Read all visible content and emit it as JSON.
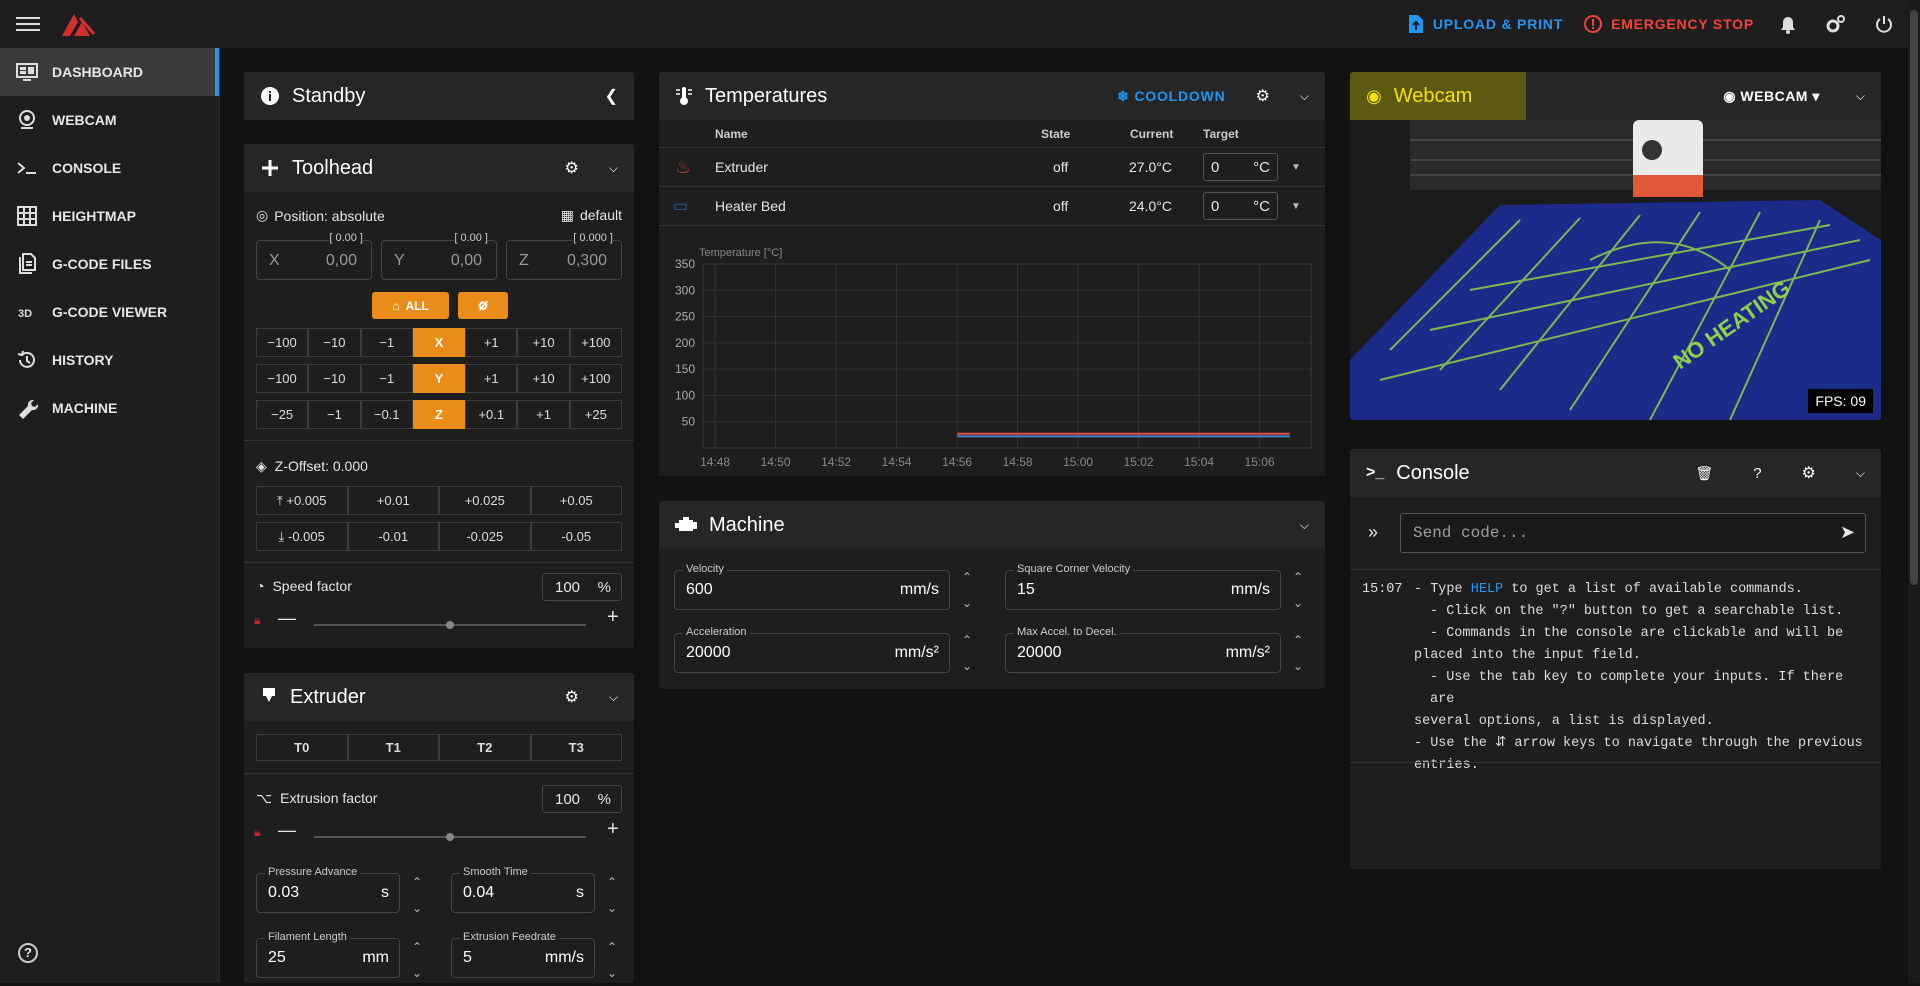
{
  "topbar": {
    "upload_label": "UPLOAD & PRINT",
    "estop_label": "EMERGENCY STOP"
  },
  "nav": [
    {
      "label": "DASHBOARD",
      "icon": "monitor-dashboard-icon"
    },
    {
      "label": "WEBCAM",
      "icon": "webcam-icon"
    },
    {
      "label": "CONSOLE",
      "icon": "console-icon"
    },
    {
      "label": "HEIGHTMAP",
      "icon": "grid-icon"
    },
    {
      "label": "G-CODE FILES",
      "icon": "file-document-icon"
    },
    {
      "label": "G-CODE VIEWER",
      "icon": "3d-icon"
    },
    {
      "label": "HISTORY",
      "icon": "history-icon"
    },
    {
      "label": "MACHINE",
      "icon": "wrench-icon"
    }
  ],
  "standby": {
    "title": "Standby"
  },
  "toolhead": {
    "title": "Toolhead",
    "position_label": "Position: absolute",
    "profile": "default",
    "axes": [
      {
        "name": "X",
        "value": "0,00",
        "hint": "[ 0.00 ]"
      },
      {
        "name": "Y",
        "value": "0,00",
        "hint": "[ 0.00 ]"
      },
      {
        "name": "Z",
        "value": "0,300",
        "hint": "[ 0.000 ]"
      }
    ],
    "home_all": "ALL",
    "x_row": [
      "−100",
      "−10",
      "−1",
      "X",
      "+1",
      "+10",
      "+100"
    ],
    "y_row": [
      "−100",
      "−10",
      "−1",
      "Y",
      "+1",
      "+10",
      "+100"
    ],
    "z_row": [
      "−25",
      "−1",
      "−0.1",
      "Z",
      "+0.1",
      "+1",
      "+25"
    ],
    "zoffset_label": "Z-Offset: 0.000",
    "zoff_up": [
      "+0.005",
      "+0.01",
      "+0.025",
      "+0.05"
    ],
    "zoff_down": [
      "-0.005",
      "-0.01",
      "-0.025",
      "-0.05"
    ],
    "speed_label": "Speed factor",
    "speed_value": "100",
    "speed_unit": "%"
  },
  "extruder": {
    "title": "Extruder",
    "tools": [
      "T0",
      "T1",
      "T2",
      "T3"
    ],
    "extrusion_label": "Extrusion factor",
    "extrusion_value": "100",
    "extrusion_unit": "%",
    "pa_label": "Pressure Advance",
    "pa_value": "0.03",
    "pa_unit": "s",
    "st_label": "Smooth Time",
    "st_value": "0.04",
    "st_unit": "s",
    "fl_label": "Filament Length",
    "fl_value": "25",
    "fl_unit": "mm",
    "ef_label": "Extrusion Feedrate",
    "ef_value": "5",
    "ef_unit": "mm/s"
  },
  "temps": {
    "title": "Temperatures",
    "cooldown": "COOLDOWN",
    "headers": {
      "name": "Name",
      "state": "State",
      "current": "Current",
      "target": "Target"
    },
    "rows": [
      {
        "name": "Extruder",
        "state": "off",
        "current": "27.0°C",
        "target": "0",
        "unit": "°C",
        "color": "#b23a3a"
      },
      {
        "name": "Heater Bed",
        "state": "off",
        "current": "24.0°C",
        "target": "0",
        "unit": "°C",
        "color": "#2a5fa8"
      }
    ],
    "chart_label": "Temperature [°C]"
  },
  "chart_data": {
    "type": "line",
    "ylabel": "Temperature [°C]",
    "ylim": [
      0,
      350
    ],
    "yticks": [
      50,
      100,
      150,
      200,
      250,
      300,
      350
    ],
    "xticks": [
      "14:48",
      "14:50",
      "14:52",
      "14:54",
      "14:56",
      "14:58",
      "15:00",
      "15:02",
      "15:04",
      "15:06"
    ],
    "series": [
      {
        "name": "Extruder",
        "color": "#e05050",
        "x": [
          "14:56",
          "15:07"
        ],
        "values": [
          27,
          27
        ]
      },
      {
        "name": "Heater Bed",
        "color": "#4a7fd0",
        "x": [
          "14:56",
          "15:07"
        ],
        "values": [
          24,
          24
        ]
      }
    ]
  },
  "machine": {
    "title": "Machine",
    "velocity_label": "Velocity",
    "velocity_value": "600",
    "velocity_unit": "mm/s",
    "scv_label": "Square Corner Velocity",
    "scv_value": "15",
    "scv_unit": "mm/s",
    "accel_label": "Acceleration",
    "accel_value": "20000",
    "accel_unit": "mm/s²",
    "decel_label": "Max Accel. to Decel.",
    "decel_value": "20000",
    "decel_unit": "mm/s²"
  },
  "webcam": {
    "title": "Webcam",
    "selector": "WEBCAM",
    "fps": "FPS: 09"
  },
  "console": {
    "title": "Console",
    "placeholder": "Send code...",
    "time": "15:07",
    "lines": [
      [
        "- Type ",
        "HELP",
        " to get a list of available commands."
      ],
      [
        "- Click on the \"?\" button to get a searchable list."
      ],
      [
        "- Commands in the console are clickable and will be"
      ],
      [
        "placed into the input field."
      ],
      [
        "- Use the tab key to complete your inputs. If there are"
      ],
      [
        "several options, a list is displayed."
      ],
      [
        "- Use the ⇵ arrow keys to navigate through the previous"
      ],
      [
        "entries."
      ]
    ]
  }
}
